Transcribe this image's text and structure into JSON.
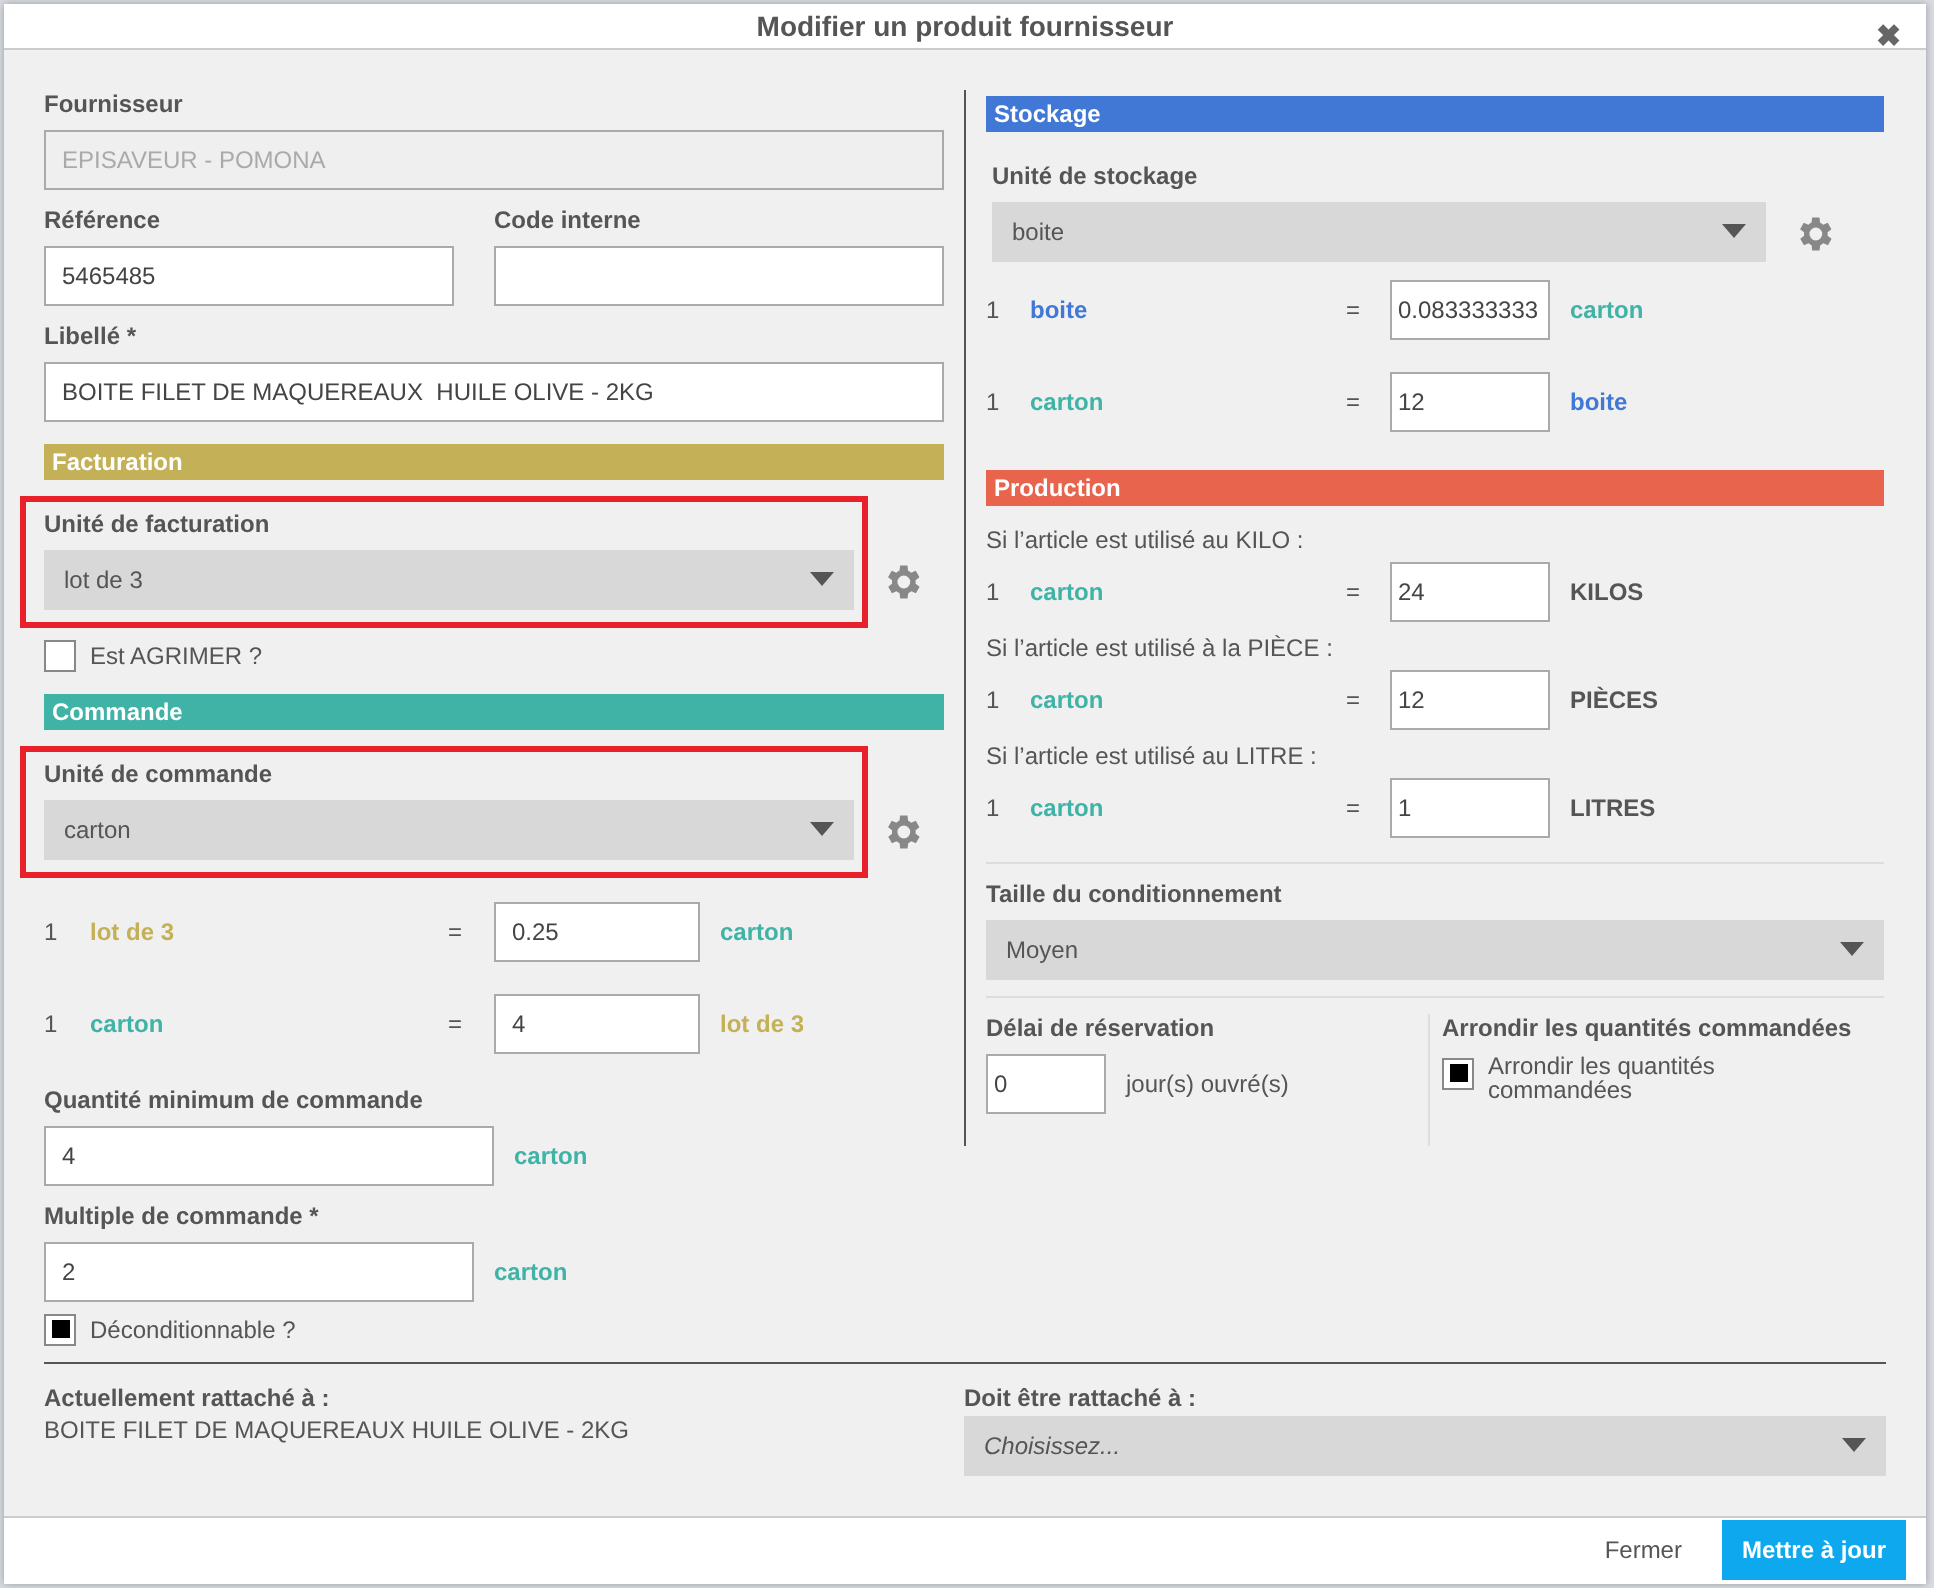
{
  "window": {
    "title": "Modifier un produit fournisseur",
    "close_glyph": "✖"
  },
  "left": {
    "fournisseur": {
      "label": "Fournisseur",
      "value": "EPISAVEUR - POMONA",
      "disabled": true
    },
    "reference": {
      "label": "Référence",
      "value": "5465485"
    },
    "code_interne": {
      "label": "Code interne"
    },
    "libelle": {
      "label": "Libellé *",
      "value": "BOITE FILET DE MAQUEREAUX  HUILE OLIVE - 2KG"
    },
    "facturation": {
      "title": "Facturation",
      "color": "#c4b157",
      "select": {
        "label": "Unité de facturation",
        "value": "lot de 3",
        "highlighted": true
      },
      "checkbox": {
        "label": "Est AGRIMER ?",
        "checked": false
      }
    },
    "commande": {
      "title": "Commande",
      "color": "#40b3a6",
      "select": {
        "label": "Unité de commande",
        "value": "carton",
        "highlighted": true
      },
      "conversions": [
        {
          "qty": "1",
          "unit": {
            "text": "lot de 3",
            "color": "#c4b157"
          },
          "op": "=",
          "value": "0.25",
          "target": {
            "text": "carton",
            "color": "#40b3a6"
          }
        },
        {
          "qty": "1",
          "unit": {
            "text": "carton",
            "color": "#40b3a6"
          },
          "op": "=",
          "value": "4",
          "target": {
            "text": "lot de 3",
            "color": "#c4b157"
          }
        }
      ],
      "min_qty": {
        "label": "Quantité minimum de commande",
        "value": "4",
        "unit": "carton"
      },
      "multiple": {
        "label": "Multiple de commande *",
        "value": "2",
        "unit": "carton"
      },
      "checkbox": {
        "label": "Déconditionnable ?",
        "checked": true
      }
    }
  },
  "right": {
    "stockage": {
      "title": "Stockage",
      "color": "#4178d5",
      "select": {
        "label": "Unité de stockage",
        "value": "boite",
        "highlighted": false
      },
      "conversions": [
        {
          "qty": "1",
          "unit": {
            "text": "boite",
            "color": "#4178d5"
          },
          "op": "=",
          "value": "0.083333333",
          "target": {
            "text": "carton",
            "color": "#40b3a6"
          }
        },
        {
          "qty": "1",
          "unit": {
            "text": "carton",
            "color": "#40b3a6"
          },
          "op": "=",
          "value": "12",
          "target": {
            "text": "boite",
            "color": "#4178d5"
          }
        }
      ]
    },
    "production": {
      "title": "Production",
      "color": "#e8644d",
      "rows": [
        {
          "condition": "Si l’article est utilisé au KILO :",
          "qty": "1",
          "unit": {
            "text": "carton",
            "color": "#40b3a6"
          },
          "op": "=",
          "value": "24",
          "target": {
            "text": "KILOS"
          }
        },
        {
          "condition": "Si l’article est utilisé à la PIÈCE :",
          "qty": "1",
          "unit": {
            "text": "carton",
            "color": "#40b3a6"
          },
          "op": "=",
          "value": "12",
          "target": {
            "text": "PIÈCES"
          }
        },
        {
          "condition": "Si l’article est utilisé au LITRE :",
          "qty": "1",
          "unit": {
            "text": "carton",
            "color": "#40b3a6"
          },
          "op": "=",
          "value": "1",
          "target": {
            "text": "LITRES"
          }
        }
      ]
    },
    "taille": {
      "label": "Taille du conditionnement",
      "value": "Moyen"
    },
    "delai": {
      "label": "Délai de réservation",
      "value": "0",
      "suffix": "jour(s) ouvré(s)"
    },
    "arrondir": {
      "label": "Arrondir les quantités commandées",
      "checkbox": {
        "label": "Arrondir les quantités commandées",
        "checked": true
      }
    }
  },
  "attachment": {
    "current": {
      "label": "Actuellement rattaché à :",
      "value": "BOITE FILET DE MAQUEREAUX HUILE OLIVE - 2KG"
    },
    "target": {
      "label": "Doit être rattaché à :",
      "placeholder": "Choisissez..."
    }
  },
  "footer": {
    "buttons": [
      {
        "label": "Fermer",
        "kind": "link"
      },
      {
        "label": "Mettre à jour",
        "kind": "primary"
      }
    ]
  }
}
